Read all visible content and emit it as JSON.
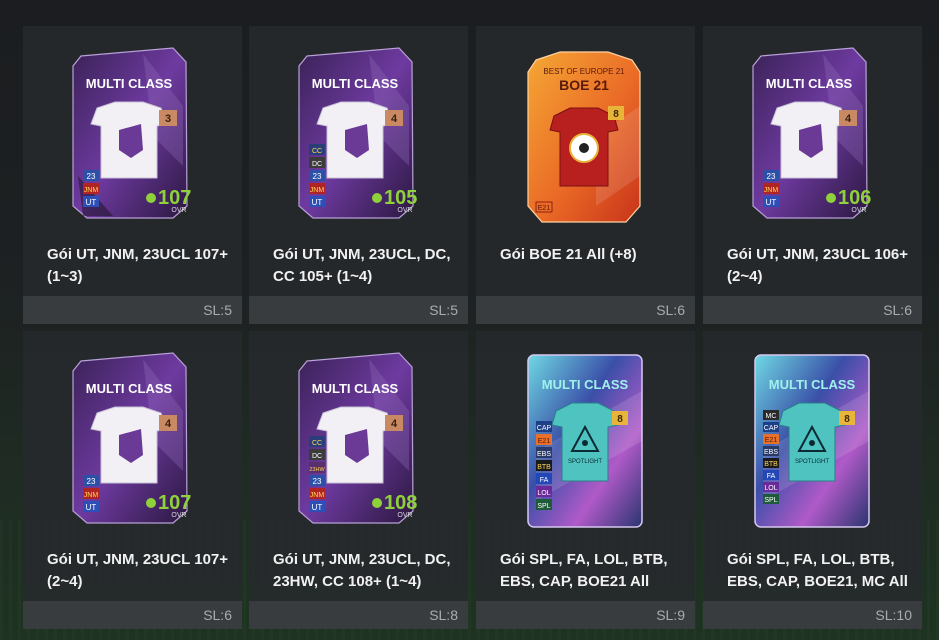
{
  "packs": [
    {
      "name": "Gói UT, JNM, 23UCL 107+ (1~3)",
      "sl": "SL:5",
      "card": {
        "title": "MULTI CLASS",
        "level": "3",
        "ovr": "107",
        "ovr_label": "OVR",
        "tags": [
          "23",
          "JNM",
          "UT"
        ]
      }
    },
    {
      "name": "Gói UT, JNM, 23UCL, DC, CC 105+ (1~4)",
      "sl": "SL:5",
      "card": {
        "title": "MULTI CLASS",
        "level": "4",
        "ovr": "105",
        "ovr_label": "OVR",
        "tags": [
          "CC",
          "DC",
          "23",
          "JNM",
          "UT"
        ]
      }
    },
    {
      "name": "Gói BOE 21 All (+8)",
      "sl": "SL:6",
      "card": {
        "title": "BOE 21",
        "subtitle": "BEST OF EUROPE 21",
        "level": "8",
        "tags": [
          "E21"
        ]
      }
    },
    {
      "name": "Gói UT, JNM, 23UCL 106+ (2~4)",
      "sl": "SL:6",
      "card": {
        "title": "MULTI CLASS",
        "level": "4",
        "ovr": "106",
        "ovr_label": "OVR",
        "tags": [
          "23",
          "JNM",
          "UT"
        ]
      }
    },
    {
      "name": "Gói UT, JNM, 23UCL 107+ (2~4)",
      "sl": "SL:6",
      "card": {
        "title": "MULTI CLASS",
        "level": "4",
        "ovr": "107",
        "ovr_label": "OVR",
        "tags": [
          "23",
          "JNM",
          "UT"
        ]
      }
    },
    {
      "name": "Gói UT, JNM, 23UCL, DC, 23HW, CC 108+ (1~4)",
      "sl": "SL:8",
      "card": {
        "title": "MULTI CLASS",
        "level": "4",
        "ovr": "108",
        "ovr_label": "OVR",
        "tags": [
          "CC",
          "DC",
          "23HW",
          "23",
          "JNM",
          "UT"
        ]
      }
    },
    {
      "name": "Gói SPL, FA, LOL, BTB, EBS, CAP, BOE21 All",
      "sl": "SL:9",
      "card": {
        "title": "MULTI CLASS",
        "level": "8",
        "emblem": "SPOTLIGHT",
        "tags": [
          "CAP",
          "E21",
          "EBS",
          "BTB",
          "FA",
          "LOL",
          "SPL"
        ]
      }
    },
    {
      "name": "Gói SPL, FA, LOL, BTB, EBS, CAP, BOE21, MC All",
      "sl": "SL:10",
      "card": {
        "title": "MULTI CLASS",
        "level": "8",
        "emblem": "SPOTLIGHT",
        "tags": [
          "MC",
          "CAP",
          "E21",
          "EBS",
          "BTB",
          "FA",
          "LOL",
          "SPL"
        ]
      }
    }
  ],
  "colors": {
    "ovr_green": "#8fd13a",
    "level_bronze": "#c98a63",
    "level_gold": "#e9b43a",
    "boe_red": "#d9451f",
    "boe_orange": "#f29a2c",
    "spotlight_cyan": "#7fe6e0"
  }
}
